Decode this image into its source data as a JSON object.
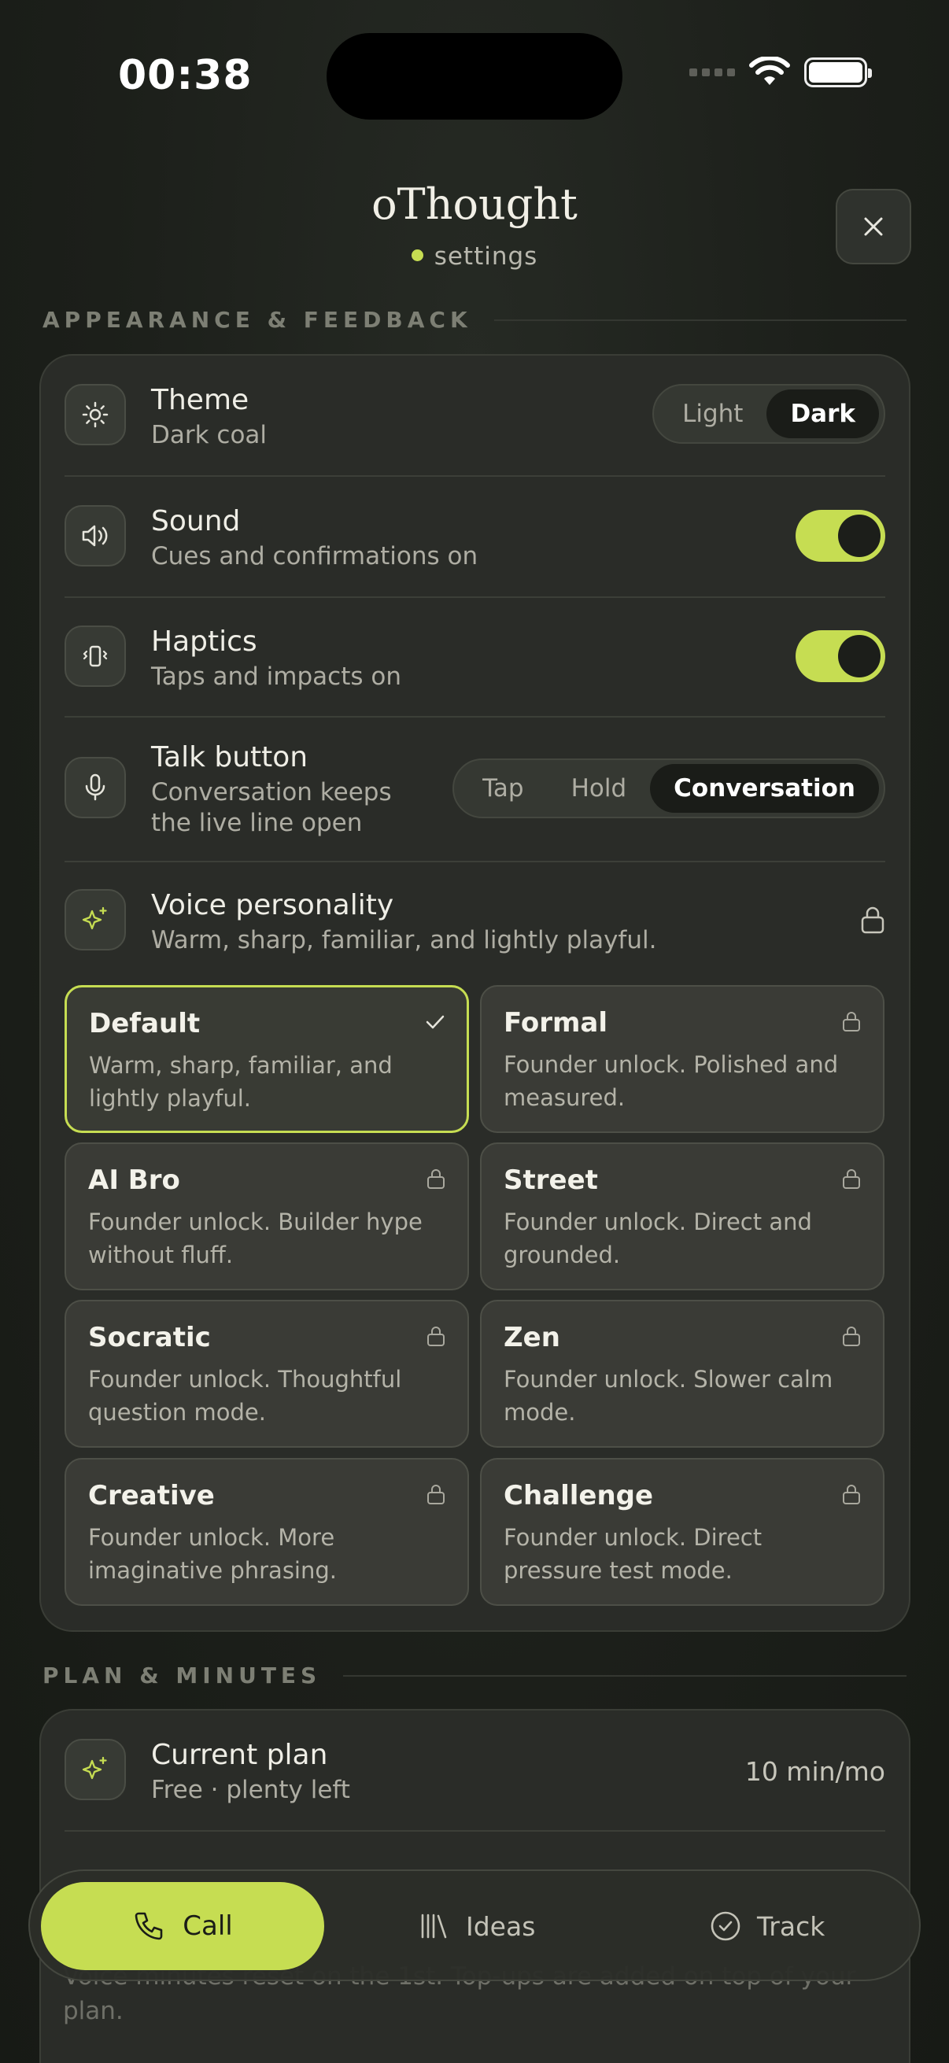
{
  "status": {
    "time": "00:38"
  },
  "header": {
    "title": "oThought",
    "subtitle": "settings"
  },
  "sections": {
    "appearance": "APPEARANCE & FEEDBACK",
    "plan": "PLAN & MINUTES"
  },
  "theme": {
    "title": "Theme",
    "subtitle": "Dark coal",
    "options": [
      "Light",
      "Dark"
    ],
    "selected": "Dark"
  },
  "sound": {
    "title": "Sound",
    "subtitle": "Cues and confirmations on",
    "enabled": true
  },
  "haptics": {
    "title": "Haptics",
    "subtitle": "Taps and impacts on",
    "enabled": true
  },
  "talk": {
    "title": "Talk button",
    "subtitle_line1": "Conversation keeps",
    "subtitle_line2": "the live line open",
    "options": [
      "Tap",
      "Hold",
      "Conversation"
    ],
    "selected": "Conversation"
  },
  "voice": {
    "title": "Voice personality",
    "subtitle": "Warm, sharp, familiar, and lightly playful.",
    "personalities": [
      {
        "name": "Default",
        "line1": "Warm, sharp, familiar, and",
        "line2": "lightly playful.",
        "selected": true,
        "locked": false
      },
      {
        "name": "Formal",
        "line1": "Founder unlock. Polished and",
        "line2": "measured.",
        "selected": false,
        "locked": true
      },
      {
        "name": "AI Bro",
        "line1": "Founder unlock. Builder hype",
        "line2": "without fluff.",
        "selected": false,
        "locked": true
      },
      {
        "name": "Street",
        "line1": "Founder unlock. Direct and",
        "line2": "grounded.",
        "selected": false,
        "locked": true
      },
      {
        "name": "Socratic",
        "line1": "Founder unlock. Thoughtful",
        "line2": "question mode.",
        "selected": false,
        "locked": true
      },
      {
        "name": "Zen",
        "line1": "Founder unlock. Slower calm",
        "line2": "mode.",
        "selected": false,
        "locked": true
      },
      {
        "name": "Creative",
        "line1": "Founder unlock. More",
        "line2": "imaginative phrasing.",
        "selected": false,
        "locked": true
      },
      {
        "name": "Challenge",
        "line1": "Founder unlock. Direct",
        "line2": "pressure test mode.",
        "selected": false,
        "locked": true
      }
    ]
  },
  "plan": {
    "title": "Current plan",
    "subtitle": "Free · plenty left",
    "value": "10 min/mo",
    "reset_line1": "Voice minutes reset on the 1st. Top-ups are added on top of your",
    "reset_line2": "plan."
  },
  "tabs": {
    "call": "Call",
    "ideas": "Ideas",
    "track": "Track"
  },
  "colors": {
    "accent": "#c6dd52",
    "background": "#1c1f1a",
    "card": "#2a2c28"
  }
}
